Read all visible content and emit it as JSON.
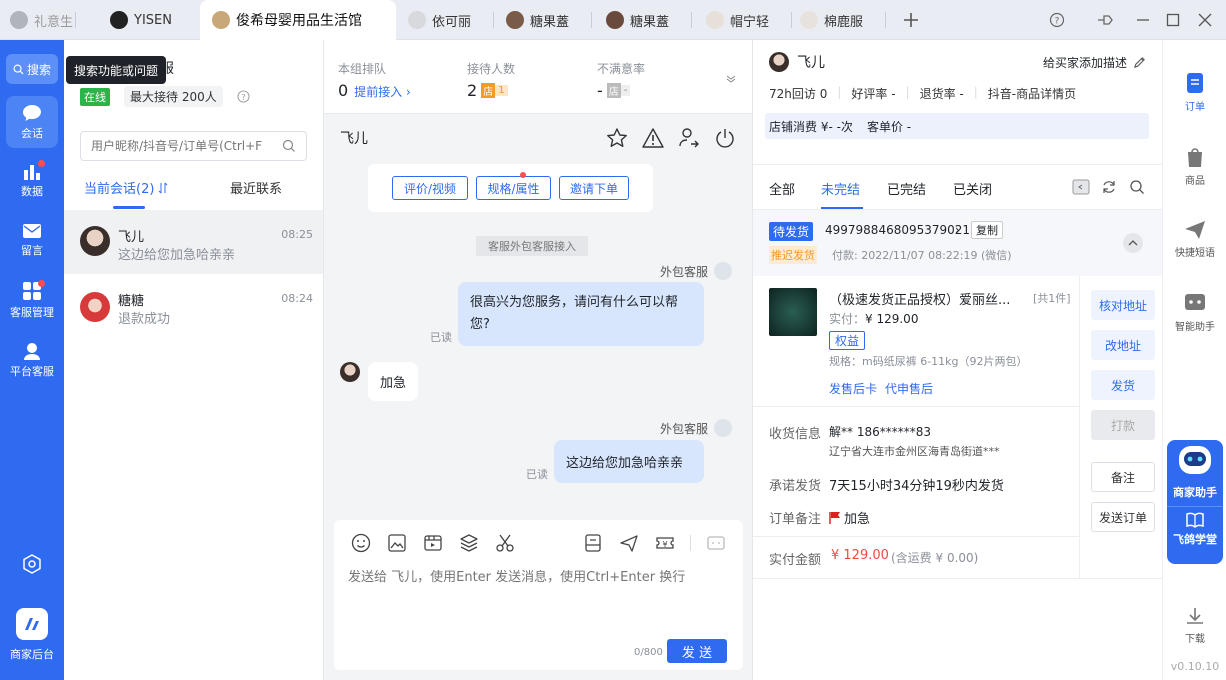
{
  "tabs": [
    {
      "label": "礼意生",
      "avatar_color": "#b0b5bd"
    },
    {
      "label": "YISEN",
      "avatar_color": "#222222"
    },
    {
      "label": "俊希母婴用品生活馆",
      "avatar_color": "#c8a878"
    },
    {
      "label": "依可丽",
      "avatar_color": "#d7d9dc"
    },
    {
      "label": "糖果蓋",
      "avatar_color": "#7a5a48"
    },
    {
      "label": "糖果蓋",
      "avatar_color": "#6b4a3e"
    },
    {
      "label": "帽宁轻",
      "avatar_color": "#e6e0d8"
    },
    {
      "label": "棉鹿服",
      "avatar_color": "#e8e2de"
    }
  ],
  "window_controls": [
    "help-icon",
    "pin-icon",
    "minimize-icon",
    "maximize-icon",
    "close-icon"
  ],
  "left_nav": {
    "search_label": "搜索",
    "tooltip": "搜索功能或问题",
    "items": [
      {
        "label": "会话",
        "icon": "chat-bubble-icon",
        "active": true,
        "dot": false
      },
      {
        "label": "数据",
        "icon": "bar-chart-icon",
        "active": false,
        "dot": true
      },
      {
        "label": "留言",
        "icon": "mail-icon",
        "active": false,
        "dot": false
      },
      {
        "label": "客服管理",
        "icon": "grid-icon",
        "active": false,
        "dot": true
      },
      {
        "label": "平台客服",
        "icon": "headset-icon",
        "active": false,
        "dot": false
      }
    ],
    "settings_icon": "settings-icon",
    "backend_label": "商家后台"
  },
  "agent": {
    "name_partial": "服",
    "status": "在线",
    "max_label": "最大接待 200人"
  },
  "session_search": {
    "placeholder": "用户昵称/抖音号/订单号(Ctrl+F"
  },
  "session_tabs": {
    "current": "当前会话(2)",
    "recent": "最近联系"
  },
  "sessions": [
    {
      "name": "飞儿",
      "time": "08:25",
      "preview": "这边给您加急哈亲亲",
      "avatar_color": "#5a4a44"
    },
    {
      "name": "糖糖",
      "time": "08:24",
      "preview": "退款成功",
      "avatar_color": "#d63a3a"
    }
  ],
  "stats": [
    {
      "label": "本组排队",
      "value": "0",
      "extra": "提前接入 ›"
    },
    {
      "label": "接待人数",
      "value": "2",
      "badge": "店",
      "badge_num": "1"
    },
    {
      "label": "不满意率",
      "value": "-",
      "badge": "店",
      "badge_num": "-"
    }
  ],
  "chat": {
    "title": "飞儿",
    "quick_buttons": [
      "评价/视频",
      "规格/属性",
      "邀请下单"
    ],
    "system_msg": "客服外包客服接入",
    "messages": [
      {
        "from": "agent",
        "sender": "外包客服",
        "text": "很高兴为您服务，请问有什么可以帮您?",
        "status": "已读"
      },
      {
        "from": "customer",
        "text": "加急"
      },
      {
        "from": "agent",
        "sender": "外包客服",
        "text": "这边给您加急哈亲亲",
        "status": "已读"
      }
    ],
    "input_placeholder": "发送给 飞儿，使用Enter 发送消息，使用Ctrl+Enter 换行",
    "char_count": "0/800",
    "send_label": "发 送"
  },
  "customer": {
    "name": "飞儿",
    "add_desc": "给买家添加描述",
    "stats_line": [
      "72h回访 0",
      "好评率 -",
      "退货率 -",
      "抖音-商品详情页"
    ],
    "shop_spend": "店铺消费 ¥- -次",
    "avg_price": "客单价 -"
  },
  "order_tabs": [
    "全部",
    "未完结",
    "已完结",
    "已关闭"
  ],
  "order": {
    "status": "待发货",
    "id": "4997988468095379021",
    "copy": "复制",
    "delay_tag": "推迟发货",
    "pay_time": "付款: 2022/11/07 08:22:19 (微信)",
    "product_title": "（极速发货正品授权）爱丽丝...",
    "qty": "[共1件]",
    "paid_label": "实付：",
    "paid": "¥ 129.00",
    "rights_tag": "权益",
    "spec": "规格：m码纸尿裤 6-11kg（92片两包）",
    "links": [
      "发售后卡",
      "代申售后"
    ],
    "side_buttons": [
      "核对地址",
      "改地址",
      "发货",
      "打款",
      "备注",
      "发送订单"
    ],
    "addr_label": "收货信息",
    "addr_name": "解** 186******83",
    "addr_detail": "辽宁省大连市金州区海青岛街道***",
    "promise_label": "承诺发货",
    "promise": "7天15小时34分钟19秒内发货",
    "remark_label": "订单备注",
    "remark": "加急",
    "total_label": "实付金额",
    "total": "¥ 129.00",
    "total_note": "(含运费 ¥ 0.00)"
  },
  "right_nav": [
    {
      "label": "订单",
      "icon": "order-icon",
      "active": true
    },
    {
      "label": "商品",
      "icon": "bag-icon",
      "active": false
    },
    {
      "label": "快捷短语",
      "icon": "send-icon",
      "active": false
    },
    {
      "label": "智能助手",
      "icon": "robot-icon",
      "active": false
    }
  ],
  "assistant": {
    "label1": "商家助手",
    "label2": "飞鸽学堂"
  },
  "download": {
    "label": "下载"
  },
  "version": "v0.10.10",
  "colors": {
    "brand": "#2f6bf0",
    "online": "#2bb44a",
    "price": "#f04b3a",
    "warn": "#f59a23"
  }
}
